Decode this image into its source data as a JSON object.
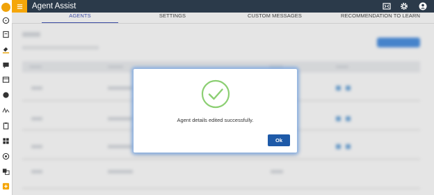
{
  "app": {
    "title": "Agent Assist"
  },
  "tabs": [
    {
      "label": "AGENTS",
      "active": true
    },
    {
      "label": "SETTINGS",
      "active": false
    },
    {
      "label": "CUSTOM MESSAGES",
      "active": false
    },
    {
      "label": "RECOMMENDATION TO LEARN",
      "active": false
    }
  ],
  "dialog": {
    "message": "Agent details edited successfully.",
    "ok_label": "Ok",
    "icon": "check-circle-icon"
  },
  "toolbar_icons": [
    "fullscreen-icon",
    "gear-icon",
    "user-account-icon"
  ],
  "sidebar_icons": [
    "app-logo-icon",
    "compass-icon",
    "contact-card-icon",
    "paint-bucket-icon",
    "chat-icon",
    "window-icon",
    "circle-icon",
    "signature-icon",
    "clipboard-icon",
    "grid-icon",
    "settings-dial-icon",
    "translate-icon",
    "plus-box-icon"
  ],
  "colors": {
    "accent": "#f5a608",
    "topbar": "#2b3a4a",
    "primary_button": "#1e5aa8",
    "success": "#8ccf73",
    "tab_active": "#3f51b5"
  }
}
